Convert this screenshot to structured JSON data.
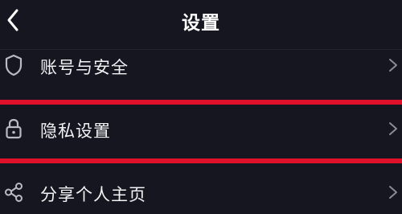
{
  "header": {
    "title": "设置",
    "back_icon": "chevron-left-icon"
  },
  "rows": [
    {
      "label": "账号与安全",
      "icon": "shield-icon"
    },
    {
      "label": "隐私设置",
      "icon": "lock-icon"
    },
    {
      "label": "分享个人主页",
      "icon": "share-icon"
    }
  ],
  "colors": {
    "background": "#15161f",
    "highlight": "#e0102a",
    "text": "#f2f2f5",
    "icon": "#b9bac3",
    "chevron": "#8a8b94"
  }
}
